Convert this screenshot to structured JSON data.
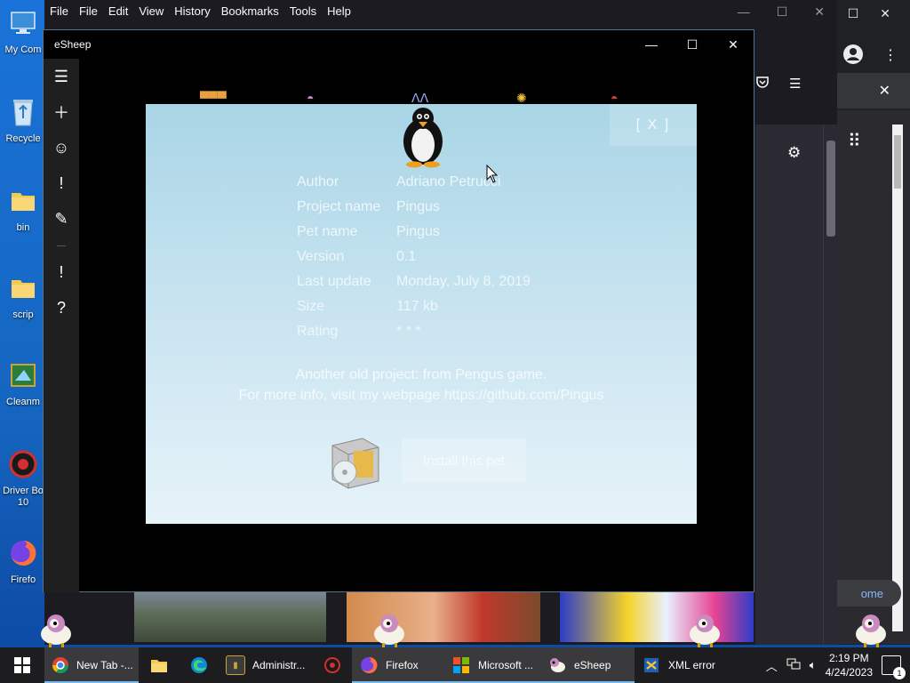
{
  "desktop": {
    "icons": [
      {
        "label": "My Com",
        "icon": "computer-icon"
      },
      {
        "label": "Recycle",
        "icon": "recycle-bin-icon"
      },
      {
        "label": "bin",
        "icon": "folder-icon"
      },
      {
        "label": "scrip",
        "icon": "folder-icon"
      },
      {
        "label": "Cleanm",
        "icon": "cleanmgr-icon"
      },
      {
        "label": "Driver Bo\n10",
        "icon": "driver-booster-icon"
      },
      {
        "label": "Firefo",
        "icon": "firefox-icon"
      }
    ]
  },
  "firefox": {
    "menu": [
      "File",
      "Edit",
      "View",
      "History",
      "Bookmarks",
      "Tools",
      "Help"
    ],
    "overlap_label": "File"
  },
  "chrome": {
    "home_label": "ome"
  },
  "esheep": {
    "title": "eSheep",
    "rail": [
      "menu-icon",
      "add-icon",
      "smiley-icon",
      "exclamation-icon",
      "pencil-icon",
      "exclamation-icon",
      "help-icon"
    ]
  },
  "pet_panel": {
    "close_label": "[ X ]",
    "fields": [
      {
        "key": "Author",
        "value": "Adriano Petrucci"
      },
      {
        "key": "Project name",
        "value": "Pingus"
      },
      {
        "key": "Pet name",
        "value": "Pingus"
      },
      {
        "key": "Version",
        "value": "0.1"
      },
      {
        "key": "Last update",
        "value": "Monday, July 8, 2019"
      },
      {
        "key": "Size",
        "value": "117 kb"
      },
      {
        "key": "Rating",
        "value": "* * *"
      }
    ],
    "description_line1": "Another old project: from Pengus game.",
    "description_line2": "For more info, visit my webpage https://github.com/Pingus",
    "install_label": "Install this pet"
  },
  "taskbar": {
    "items": [
      {
        "label": "New Tab -...",
        "icon": "chrome-icon",
        "active": true
      },
      {
        "label": "",
        "icon": "file-explorer-icon",
        "active": false
      },
      {
        "label": "",
        "icon": "edge-icon",
        "active": false
      },
      {
        "label": "Administr...",
        "icon": "terminal-icon",
        "active": false
      },
      {
        "label": "",
        "icon": "driver-booster-icon",
        "active": false
      },
      {
        "label": "Firefox",
        "icon": "firefox-icon",
        "active": true
      },
      {
        "label": "Microsoft ...",
        "icon": "microsoft-store-icon",
        "active": true
      },
      {
        "label": "eSheep",
        "icon": "esheep-icon",
        "active": true
      },
      {
        "label": "XML error",
        "icon": "xml-error-icon",
        "active": false
      }
    ],
    "time": "2:19 PM",
    "date": "4/24/2023",
    "notifications": "1"
  },
  "colors": {
    "desktop": "#1565c0",
    "panel_top": "#a9d5e6",
    "taskbar": "#1d1d1f",
    "accent": "#76b9ed"
  }
}
